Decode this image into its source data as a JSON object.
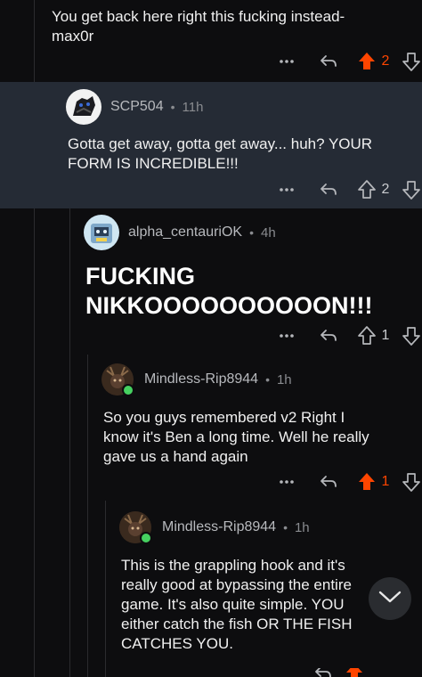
{
  "comments": [
    {
      "text": "You get back here right this fucking instead-max0r",
      "line1": "You get back here right this fucking instead-",
      "line2": "max0r",
      "votes": "2",
      "upvoted": true
    },
    {
      "username": "SCP504",
      "dot": "•",
      "time": "11h",
      "line1": "Gotta get away, gotta get away... huh? YOUR",
      "line2": "FORM IS INCREDIBLE!!!",
      "votes": "2",
      "upvoted": false
    },
    {
      "username": "alpha_centauriOK",
      "dot": "•",
      "time": "4h",
      "line1": "FUCKING",
      "line2": "NIKKOOOOOOOOOON!!!",
      "votes": "1",
      "upvoted": false
    },
    {
      "username": "Mindless-Rip8944",
      "dot": "•",
      "time": "1h",
      "line1": "So you guys remembered v2 Right I",
      "line2": "know it's Ben a long time. Well he really",
      "line3": "gave us a hand again",
      "votes": "1",
      "upvoted": true
    },
    {
      "username": "Mindless-Rip8944",
      "dot": "•",
      "time": "1h",
      "line1": "This is the  grappling hook and it's",
      "line2": "really good at bypassing the entire",
      "line3": "game. It's also quite simple. YOU",
      "line4": "either catch the fish OR THE FISH",
      "line5": "CATCHES YOU."
    }
  ],
  "icons": {
    "more": "more-options-icon",
    "reply": "reply-icon",
    "upvote": "upvote-icon",
    "downvote": "downvote-icon",
    "scroll": "chevron-down-icon"
  },
  "colors": {
    "background": "#0d0d0f",
    "highlight": "#252b35",
    "upvote_active": "#ff4500",
    "online": "#46d160"
  }
}
